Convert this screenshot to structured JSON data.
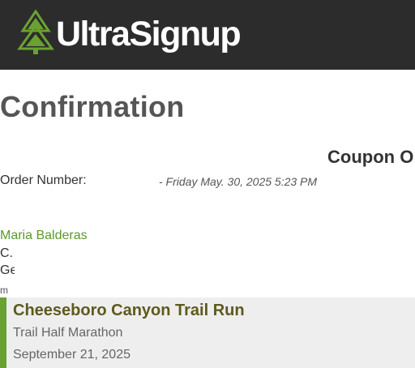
{
  "header": {
    "logo_text": "UltraSignup",
    "logo_icon": "tree-icon",
    "background_color": "#2c2c2c",
    "accent_color": "#6aa231"
  },
  "page": {
    "title": "Confirmation"
  },
  "coupon": {
    "heading": "Coupon O"
  },
  "order": {
    "label": "Order Number:",
    "datetime": "- Friday May. 30, 2025 5:23 PM"
  },
  "participant": {
    "name": "Maria Balderas",
    "address_line1": "C.",
    "address_line2": "Ge",
    "address_line3": "m"
  },
  "event": {
    "title": "Cheeseboro Canyon Trail Run",
    "distance": "Trail Half Marathon",
    "date": "September 21, 2025"
  }
}
